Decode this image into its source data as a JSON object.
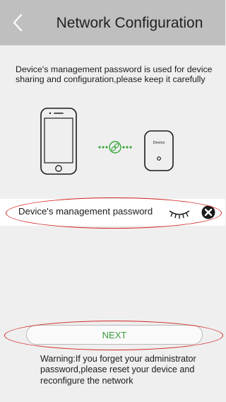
{
  "header": {
    "title": "Network Configuration",
    "back_icon": "chevron-left-icon"
  },
  "description": "Device's management password is used for device sharing and configuration,please keep it carefully",
  "illustration": {
    "device_label": "Device",
    "icons": [
      "phone-icon",
      "link-icon",
      "device-icon"
    ],
    "link_color": "#3aa83a"
  },
  "password_field": {
    "label": "Device's management password",
    "visibility_icon": "eye-closed-icon",
    "clear_icon": "clear-icon"
  },
  "next_button": {
    "label": "NEXT",
    "color": "#3a9a3a"
  },
  "warning": "Warning:If you forget your administrator password,please reset your device and reconfigure the network",
  "colors": {
    "header_bg": "#bfbfbf",
    "page_bg": "#efefef",
    "annotation": "#d22525"
  }
}
